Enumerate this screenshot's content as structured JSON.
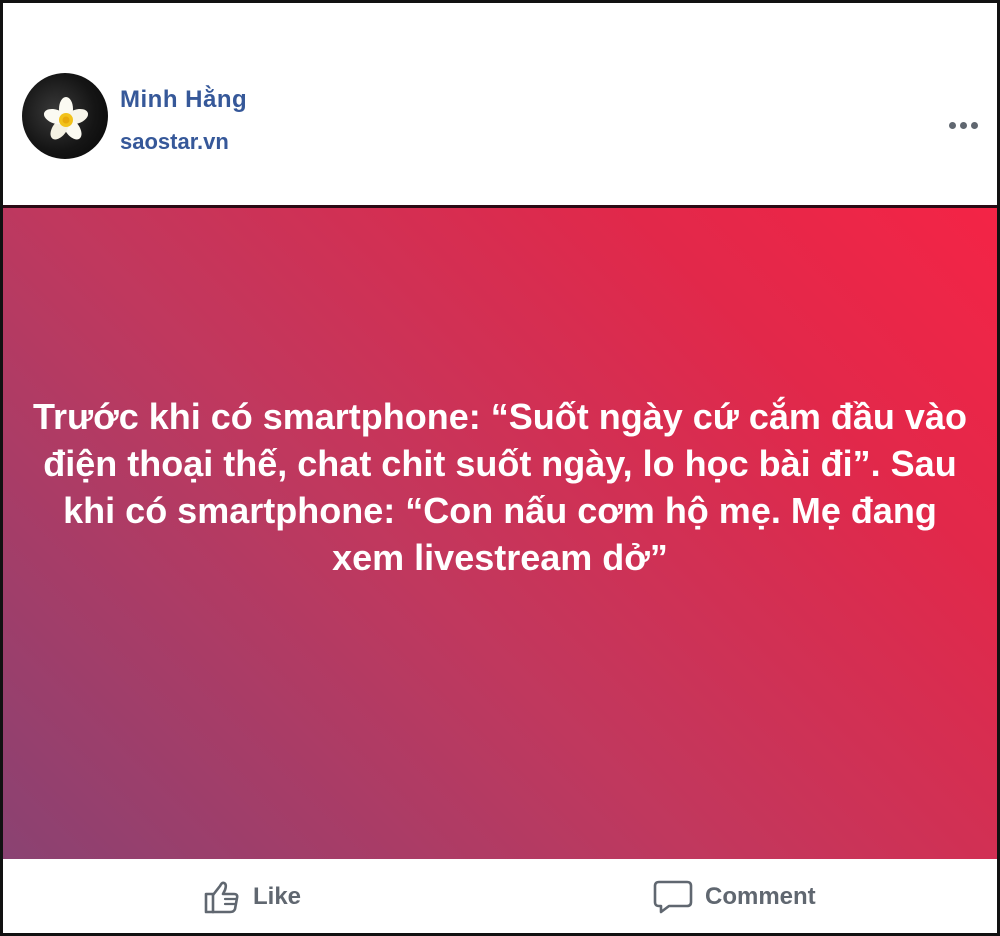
{
  "post": {
    "author": "Minh Hằng",
    "source": "saostar.vn",
    "text": "Trước khi có smartphone: “Suốt ngày cứ cắm đầu vào điện thoại thế, chat chit suốt ngày, lo học bài đi”. Sau khi có smartphone: “Con nấu cơm hộ mẹ. Mẹ đang xem livestream dở”",
    "background_colors": [
      "#8a4272",
      "#c0385e",
      "#e2284a",
      "#f42446"
    ]
  },
  "actions": {
    "like_label": "Like",
    "comment_label": "Comment"
  },
  "icons": {
    "avatar": "plumeria-flower-avatar",
    "more": "more-options-icon",
    "like": "thumbs-up-icon",
    "comment": "comment-bubble-icon"
  },
  "colors": {
    "author_name": "#365899",
    "action_text": "#606770"
  }
}
